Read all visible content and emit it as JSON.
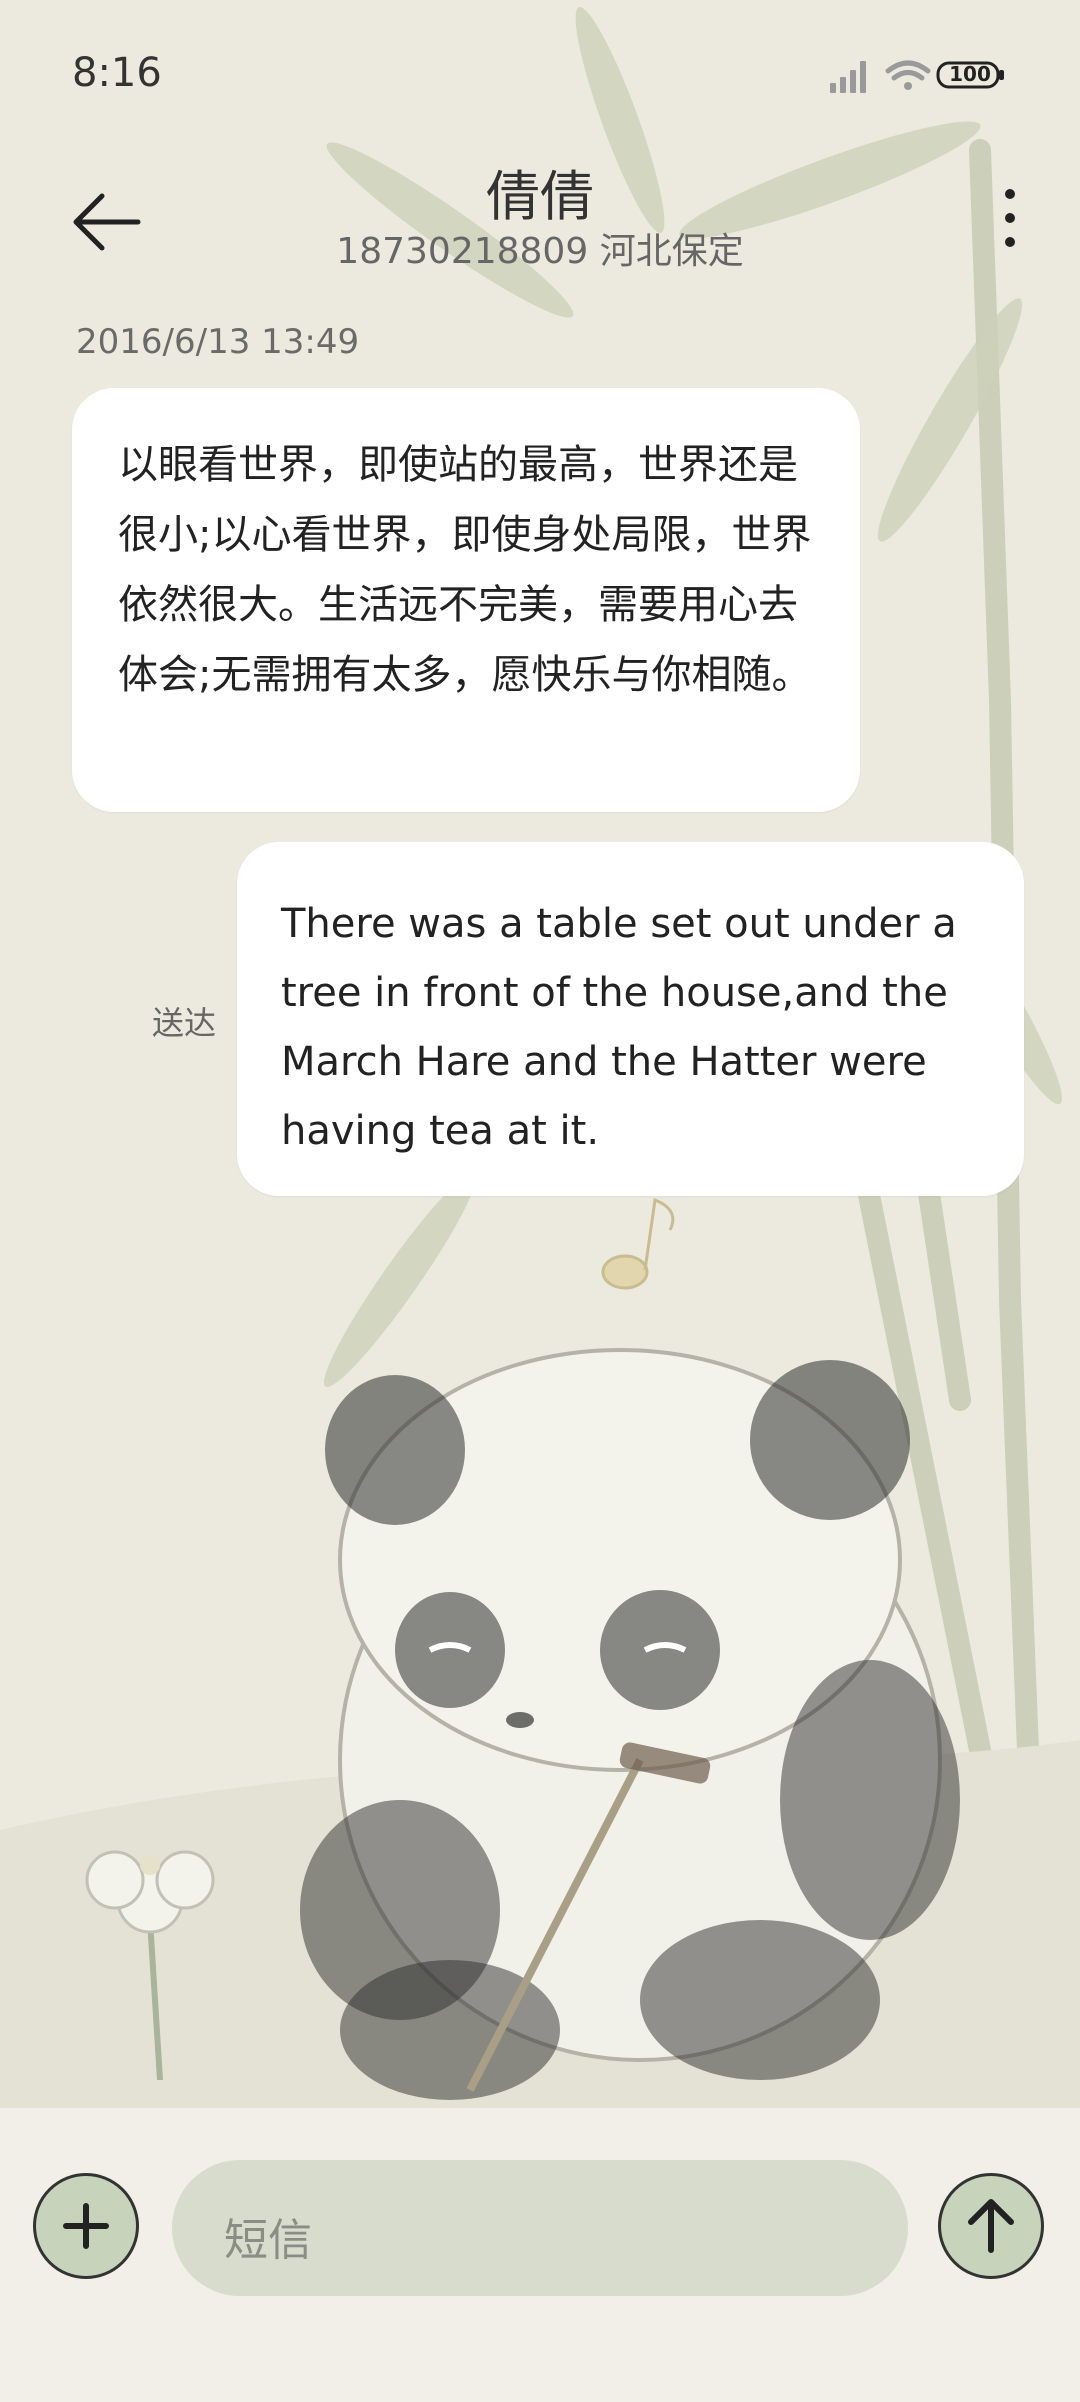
{
  "status_bar": {
    "time": "8:16",
    "battery": "100",
    "icons": [
      "signal-icon",
      "wifi-icon",
      "battery-icon"
    ]
  },
  "header": {
    "contact_name": "倩倩",
    "contact_info": "18730218809 河北保定"
  },
  "conversation": {
    "timestamp": "2016/6/13 13:49",
    "messages": [
      {
        "direction": "incoming",
        "text": "以眼看世界，即使站的最高，世界还是很小;以心看世界，即使身处局限，世界依然很大。生活远不完美，需要用心去体会;无需拥有太多，愿快乐与你相随。"
      },
      {
        "direction": "outgoing",
        "text": "There was a table set out under a tree in front of the house,and the March Hare and the Hatter were having tea at it.",
        "status": "送达"
      }
    ]
  },
  "composer": {
    "placeholder": "短信"
  },
  "colors": {
    "background": "#ECEADF",
    "bubble": "#FFFFFF",
    "button_fill": "#C8D3BB",
    "input_fill": "#D7DCCD"
  }
}
